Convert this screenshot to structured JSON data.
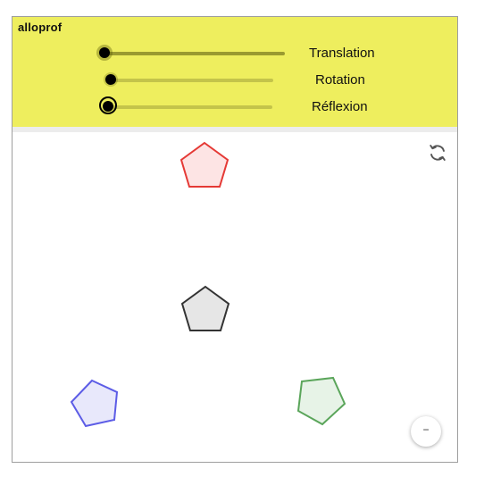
{
  "brand": {
    "logo_text": "alloprof"
  },
  "sliders": [
    {
      "label": "Translation",
      "value": 0.0
    },
    {
      "label": "Rotation",
      "value": 0.0
    },
    {
      "label": "Réflexion",
      "value": 0.0
    }
  ],
  "toolbar": {
    "reset_icon": "refresh-icon",
    "zoom_icon": "minus-icon",
    "zoom_label": "−"
  },
  "shapes": [
    {
      "name": "red-pentagon",
      "stroke": "#e53935",
      "fill": "#fde4e4"
    },
    {
      "name": "black-pentagon",
      "stroke": "#333333",
      "fill": "#e6e6e6"
    },
    {
      "name": "blue-pentagon",
      "stroke": "#5c5ce6",
      "fill": "#e8e8fb"
    },
    {
      "name": "green-pentagon",
      "stroke": "#5aa55a",
      "fill": "#e7f3e7"
    }
  ],
  "colors": {
    "panel": "#eeee5e",
    "track_dark": "#9a9a30",
    "track_light": "#c4c44a"
  }
}
